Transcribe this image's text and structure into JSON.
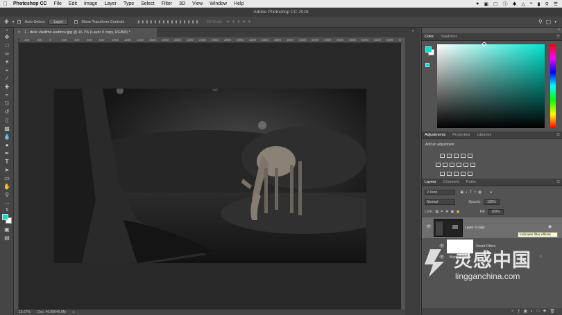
{
  "menubar": {
    "app_name": "Photoshop CC",
    "items": [
      "File",
      "Edit",
      "Image",
      "Layer",
      "Type",
      "Select",
      "Filter",
      "3D",
      "View",
      "Window",
      "Help"
    ]
  },
  "window_title": "Adobe Photoshop CC 2018",
  "options": {
    "auto_select_label": "Auto-Select:",
    "auto_select_value": "Layer",
    "transform_label": "Show Transform Controls",
    "mode_label": "3D Mode:"
  },
  "document": {
    "tab_label": "1 - deer-vladimir-kudinov.jpg @ 16.7% (Layer 0 copy, RGB/8) *",
    "ruler_ticks": [
      "400",
      "200",
      "0",
      "200",
      "400",
      "600",
      "800",
      "1000",
      "1200",
      "1400",
      "1600",
      "1800",
      "2000",
      "2200",
      "2400",
      "2600",
      "2800",
      "3000",
      "3200",
      "3400",
      "3600",
      "3800",
      "4000",
      "4200",
      "4400",
      "4600",
      "4800",
      "5000",
      "5200",
      "5400",
      "5600"
    ]
  },
  "status": {
    "zoom": "16.67%",
    "doc": "Doc: 46.8M/46.8M"
  },
  "panels": {
    "color_tabs": [
      "Color",
      "Swatches"
    ],
    "adjust_tabs": [
      "Adjustments",
      "Properties",
      "Libraries"
    ],
    "add_adjustment": "Add an adjustment",
    "layers_tabs": [
      "Layers",
      "Channels",
      "Paths"
    ],
    "kind_label": "Kind",
    "blend_mode": "Normal",
    "opacity_label": "Opacity:",
    "opacity_value": "100%",
    "lock_label": "Lock:",
    "fill_label": "Fill:",
    "fill_value": "100%",
    "layer_name": "Layer 0 copy",
    "smart_filters": "Smart Filters",
    "filter_name": "Black & White",
    "tooltip": "Indicates filter effects"
  },
  "watermark": {
    "cn": "灵感中国",
    "url": "lingganchina.com"
  },
  "colors": {
    "accent": "#00e5d0",
    "panel_bg": "#535353",
    "canvas_bg": "#282828"
  }
}
